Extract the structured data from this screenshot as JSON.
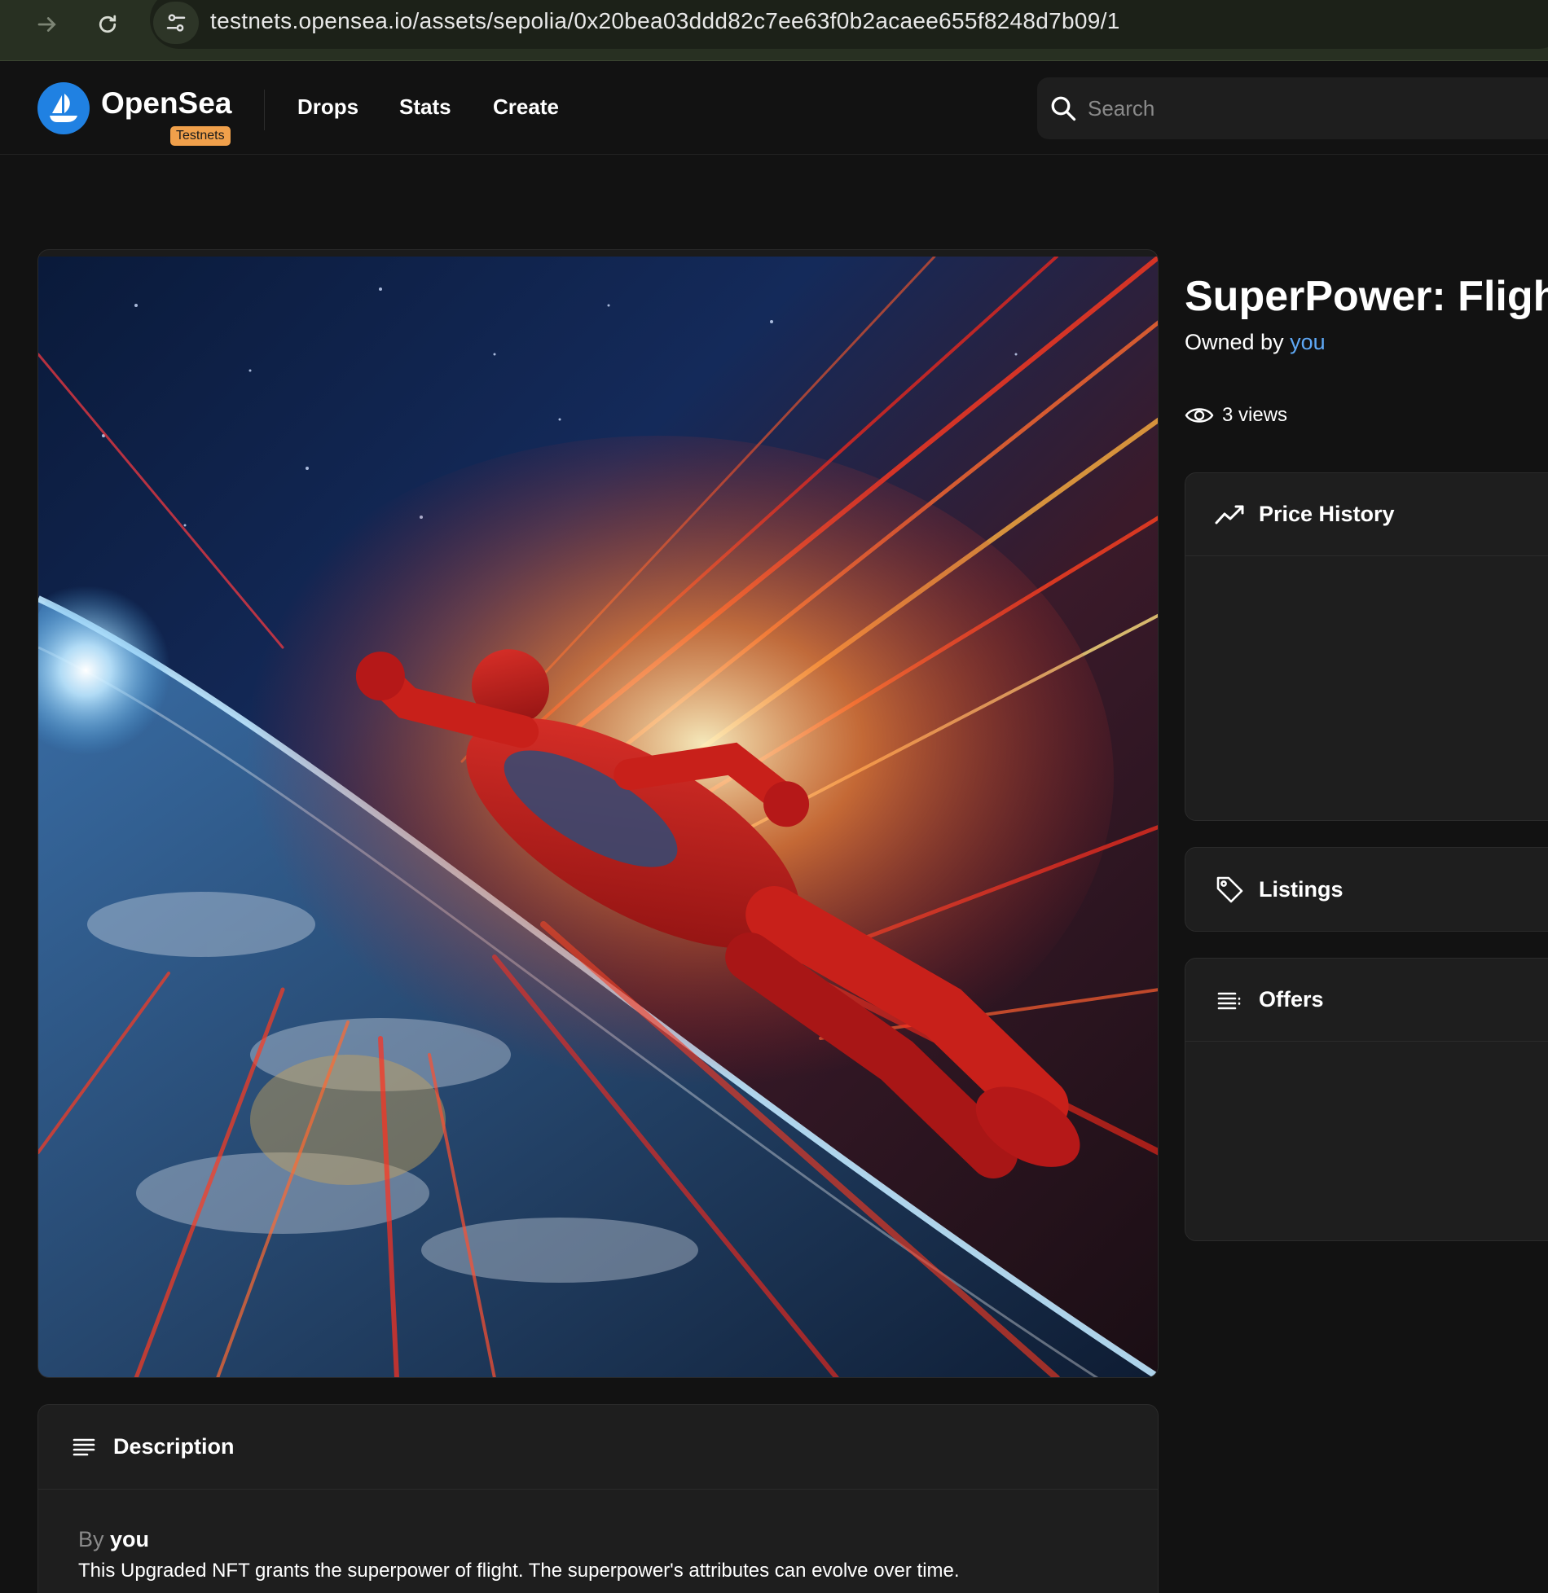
{
  "browser": {
    "url": "testnets.opensea.io/assets/sepolia/0x20bea03ddd82c7ee63f0b2acaee655f8248d7b09/1"
  },
  "header": {
    "logo_text": "OpenSea",
    "badge": "Testnets",
    "nav": [
      {
        "label": "Drops"
      },
      {
        "label": "Stats"
      },
      {
        "label": "Create"
      }
    ],
    "search_placeholder": "Search"
  },
  "asset": {
    "title": "SuperPower: Flight",
    "owned_by_prefix": "Owned by",
    "owner": "you",
    "views": "3 views"
  },
  "panels": {
    "price_history": "Price History",
    "listings": "Listings",
    "offers": "Offers"
  },
  "description": {
    "title": "Description",
    "by_prefix": "By",
    "by_name": "you",
    "text": "This Upgraded NFT grants the superpower of flight. The superpower's attributes can evolve over time."
  },
  "colors": {
    "brand": "#2081e2",
    "badge": "#f0a04b",
    "link": "#5fa8f5",
    "background": "#121212"
  }
}
